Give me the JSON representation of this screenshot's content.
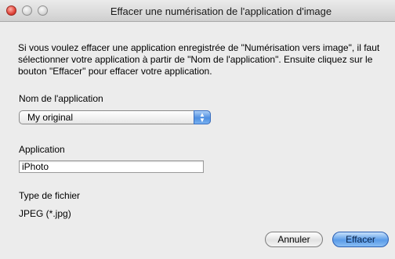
{
  "window": {
    "title": "Effacer une numérisation de l'application d'image"
  },
  "description": "Si vous voulez effacer une application enregistrée de \"Numérisation vers image\", il faut sélectionner votre application à partir de \"Nom de l'application\". Ensuite cliquez sur le bouton \"Effacer\" pour effacer votre application.",
  "app_name": {
    "label": "Nom de l'application",
    "selected": "My original"
  },
  "application": {
    "label": "Application",
    "value": "iPhoto"
  },
  "file_type": {
    "label": "Type de fichier",
    "value": "JPEG (*.jpg)"
  },
  "buttons": {
    "cancel": "Annuler",
    "delete": "Effacer"
  },
  "icons": {
    "close": "close-icon",
    "minimize": "minimize-icon",
    "zoom": "zoom-icon",
    "select_arrows": "updown-arrows-icon"
  },
  "colors": {
    "window_bg": "#ececec",
    "accent": "#5a9be8"
  }
}
